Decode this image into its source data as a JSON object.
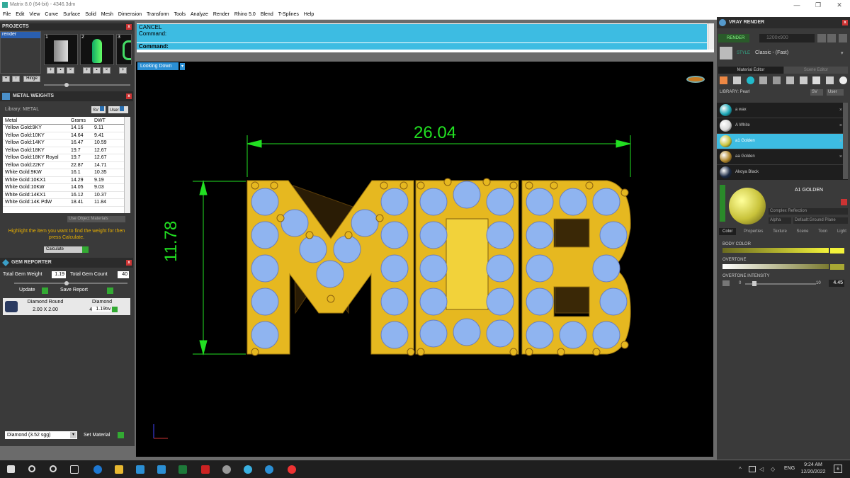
{
  "window": {
    "title": "Matrix 8.0 (64-bit) - 4346.3dm",
    "minimize": "—",
    "maximize": "❐",
    "close": "✕"
  },
  "menu": [
    "File",
    "Edit",
    "View",
    "Curve",
    "Surface",
    "Solid",
    "Mesh",
    "Dimension",
    "Transform",
    "Tools",
    "Analyze",
    "Render",
    "Rhino 5.0",
    "Blend",
    "T-Splines",
    "Help"
  ],
  "projects": {
    "header": "PROJECTS",
    "item": "render",
    "thumb_numbers": [
      "1",
      "2",
      "3"
    ],
    "hinge_label": "Hinge"
  },
  "metal_weights": {
    "header": "METAL WEIGHTS",
    "library": "Library: METAL",
    "columns": [
      "Metal",
      "Grams",
      "DWT"
    ],
    "rows": [
      [
        "Yellow Gold:9KY",
        "14.16",
        "9.11"
      ],
      [
        "Yellow Gold:10KY",
        "14.64",
        "9.41"
      ],
      [
        "Yellow Gold:14KY",
        "16.47",
        "10.59"
      ],
      [
        "Yellow Gold:18KY",
        "19.7",
        "12.67"
      ],
      [
        "Yellow Gold:18KY Royal",
        "19.7",
        "12.67"
      ],
      [
        "Yellow Gold:22KY",
        "22.87",
        "14.71"
      ],
      [
        "White Gold:9KW",
        "16.1",
        "10.35"
      ],
      [
        "White Gold:10KX1",
        "14.29",
        "9.19"
      ],
      [
        "White Gold:10KW",
        "14.05",
        "9.03"
      ],
      [
        "White Gold:14KX1",
        "16.12",
        "10.37"
      ],
      [
        "White Gold:14K PdW",
        "18.41",
        "11.84"
      ]
    ],
    "use_object_materials": "Use Object Materials",
    "hint": "Highlight the item you want to find the weight for then press Calculate.",
    "calculate": "Calculate"
  },
  "gem_reporter": {
    "header": "GEM REPORTER",
    "total_gem_weight_label": "Total Gem Weight",
    "total_gem_weight": "1.19",
    "total_gem_count_label": "Total Gem Count",
    "total_gem_count": "40",
    "update": "Update",
    "save_report": "Save Report",
    "gem": {
      "shape": "Diamond Round",
      "size": "2.00 X 2.00",
      "type": "Diamond",
      "count": "40",
      "weight": "1.19tw"
    },
    "material_select": "Diamond    (3.52 sgg)",
    "set_material": "Set Material"
  },
  "command": {
    "cancel": "CANCEL",
    "command1": "Command:",
    "command2": "Command:"
  },
  "viewport": {
    "label": "Looking Down",
    "dim_width": "26.04",
    "dim_height": "11.78",
    "letters": "MOB"
  },
  "vray": {
    "header": "VRAY RENDER",
    "render": "RENDER",
    "resolution": "1200x900",
    "style_label": "STYLE",
    "style_value": "Classic - (Fast)",
    "tab_material": "Material Editor",
    "tab_scene": "Scene Editor",
    "library": "LIBRARY: Pearl",
    "sv": "SV",
    "user": "User",
    "materials": [
      {
        "name": "a wax",
        "color": "#1aa7b6"
      },
      {
        "name": "A White",
        "color": "#d9d9d9"
      },
      {
        "name": "a1 Golden",
        "color": "#c8c23a"
      },
      {
        "name": "aa Golden",
        "color": "#b0862a"
      },
      {
        "name": "Akoya Black",
        "color": "#1c2a44"
      }
    ],
    "selected_name": "A1 GOLDEN",
    "reflection": "Complex Reflection",
    "alpha": "Alpha",
    "ground_plane": "Default:Ground Plane",
    "sub_tabs": [
      "Color",
      "Properties",
      "Texture",
      "Scene",
      "Toon",
      "Light"
    ],
    "body_color": "BODY COLOR",
    "overtone": "OVERTONE",
    "overtone_intensity": "OVERTONE INTENSITY",
    "intensity_min": "0",
    "intensity_max": "10",
    "intensity_value": "4.45"
  },
  "taskbar": {
    "language": "ENG",
    "time": "9:24 AM",
    "date": "12/20/2022",
    "notifications": "6"
  },
  "colors": {
    "accent": "#3dbce2",
    "gold": "#e6b820",
    "gem": "#8fb4f0",
    "dim": "#22e022"
  }
}
